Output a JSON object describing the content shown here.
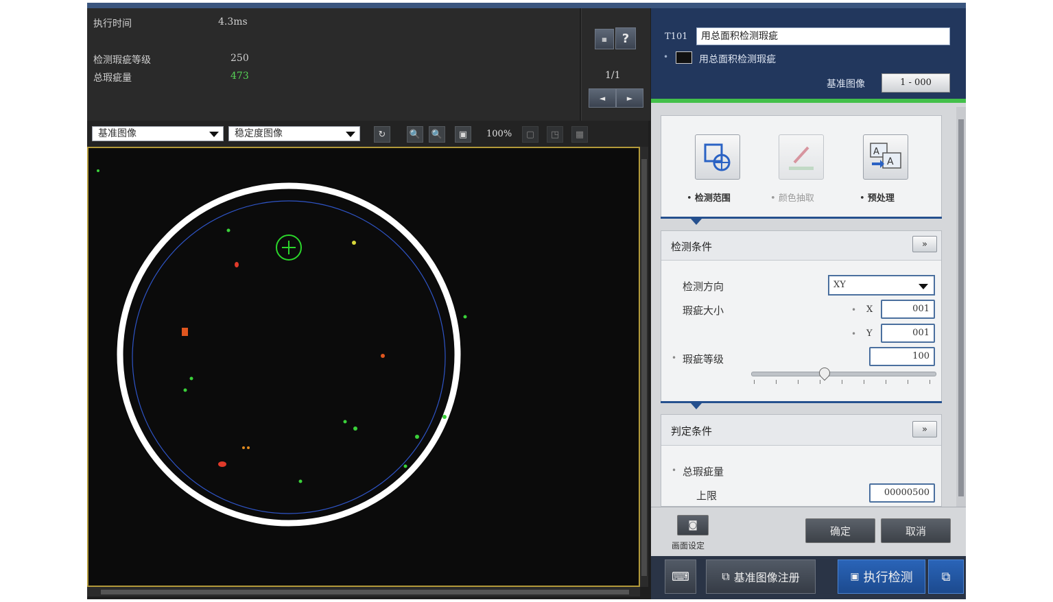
{
  "info": {
    "exec_time_label": "执行时间",
    "exec_time_value": "4.3ms",
    "level_label": "检测瑕疵等级",
    "level_value": "250",
    "total_label": "总瑕疵量",
    "total_value": "473"
  },
  "pager": {
    "help_label": "?",
    "page": "1/1",
    "prev": "◄",
    "next": "►"
  },
  "toolbar": {
    "combo1": "基准图像",
    "combo2": "稳定度图像",
    "zoom": "100%"
  },
  "tool": {
    "id": "T101",
    "name_value": "用总面积检测瑕疵",
    "name_label": "用总面积检测瑕疵",
    "ref_label": "基准图像",
    "ref_value": "1 - 000"
  },
  "icons": {
    "range": "检测范围",
    "color": "颜色抽取",
    "preprocess": "预处理"
  },
  "detect": {
    "title": "检测条件",
    "expand": "»",
    "direction_label": "检测方向",
    "direction_value": "XY",
    "size_label": "瑕疵大小",
    "x_label": "X",
    "x_value": "001",
    "y_label": "Y",
    "y_value": "001",
    "level_label": "瑕疵等级",
    "level_value": "100"
  },
  "judge": {
    "title": "判定条件",
    "expand": "»",
    "total_label": "总瑕疵量",
    "upper_label": "上限",
    "upper_value": "00000500"
  },
  "bottom": {
    "screen_setting": "画面设定",
    "ok": "确定",
    "cancel": "取消"
  },
  "footer": {
    "register": "基准图像注册",
    "run": "执行检测"
  },
  "colors": {
    "accent": "#43c04a",
    "header_blue": "#22375d",
    "run_blue": "#1f56a3"
  }
}
